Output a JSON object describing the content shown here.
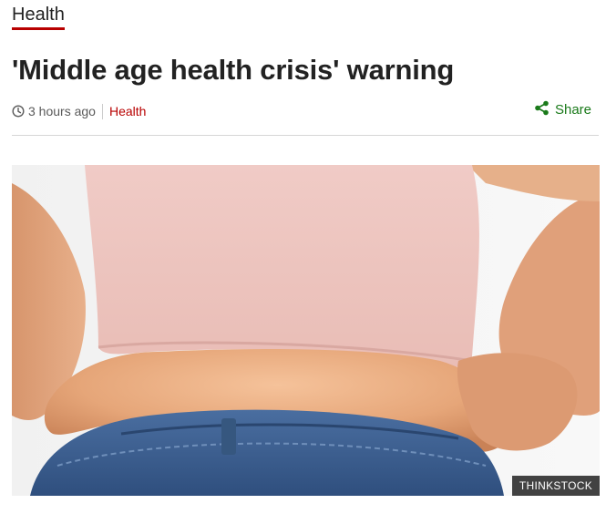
{
  "section": {
    "label": "Health"
  },
  "article": {
    "headline": "'Middle age health crisis' warning",
    "timestamp": "3 hours ago",
    "section_tag": "Health",
    "share_label": "Share",
    "image_credit": "THINKSTOCK",
    "image_alt": "Person with a belly overhanging jeans"
  },
  "colors": {
    "accent_red": "#b80000",
    "share_green": "#1a7a1a"
  }
}
